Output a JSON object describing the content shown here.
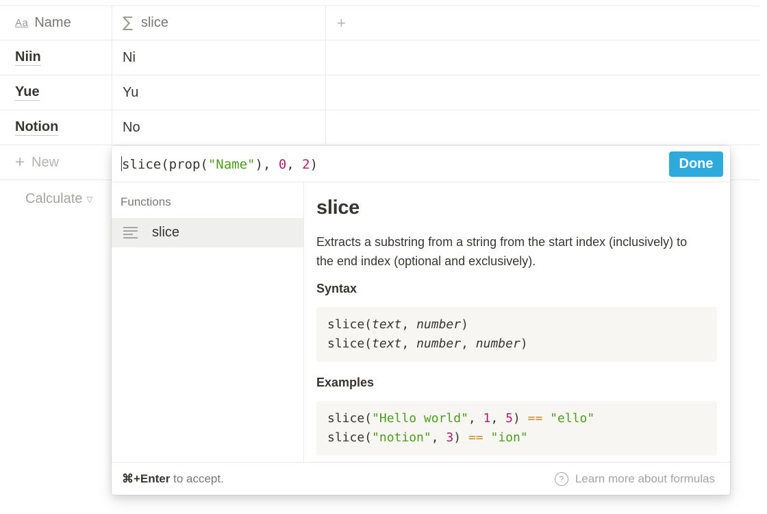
{
  "table": {
    "columns": [
      {
        "icon": "text-property-icon",
        "icon_text": "Aa",
        "label": "Name"
      },
      {
        "icon": "formula-sigma-icon",
        "icon_text": "∑",
        "label": "slice"
      },
      {
        "icon": "add-column-plus-icon",
        "icon_text": "+"
      }
    ],
    "rows": [
      {
        "name": "Niin",
        "slice": "Ni"
      },
      {
        "name": "Yue",
        "slice": "Yu"
      },
      {
        "name": "Notion",
        "slice": "No"
      }
    ],
    "new_label": "New",
    "new_icon": "+",
    "calculate_label": "Calculate",
    "calculate_chevron": "▽"
  },
  "formula": {
    "expression": "slice(prop(\"Name\"), 0, 2)",
    "done_label": "Done",
    "functions_heading": "Functions",
    "function_items": [
      "slice"
    ],
    "detail": {
      "title": "slice",
      "description": "Extracts a substring from a string from the start index (inclusively) to the end index (optional and exclusively).",
      "syntax_heading": "Syntax",
      "syntax": [
        "slice(text, number)",
        "slice(text, number, number)"
      ],
      "examples_heading": "Examples",
      "examples": [
        "slice(\"Hello world\", 1, 5) == \"ello\"",
        "slice(\"notion\", 3) == \"ion\""
      ]
    },
    "footer": {
      "shortcut": "⌘+Enter",
      "shortcut_suffix": " to accept.",
      "help_icon_text": "?",
      "learn_more": "Learn more about formulas"
    }
  },
  "colors": {
    "accent": "#2eaadc",
    "string": "#4e9c1f",
    "number": "#ac1f6b",
    "operator": "#c98a22",
    "highlight": "#efefee",
    "code_bg": "#f7f6f3"
  }
}
